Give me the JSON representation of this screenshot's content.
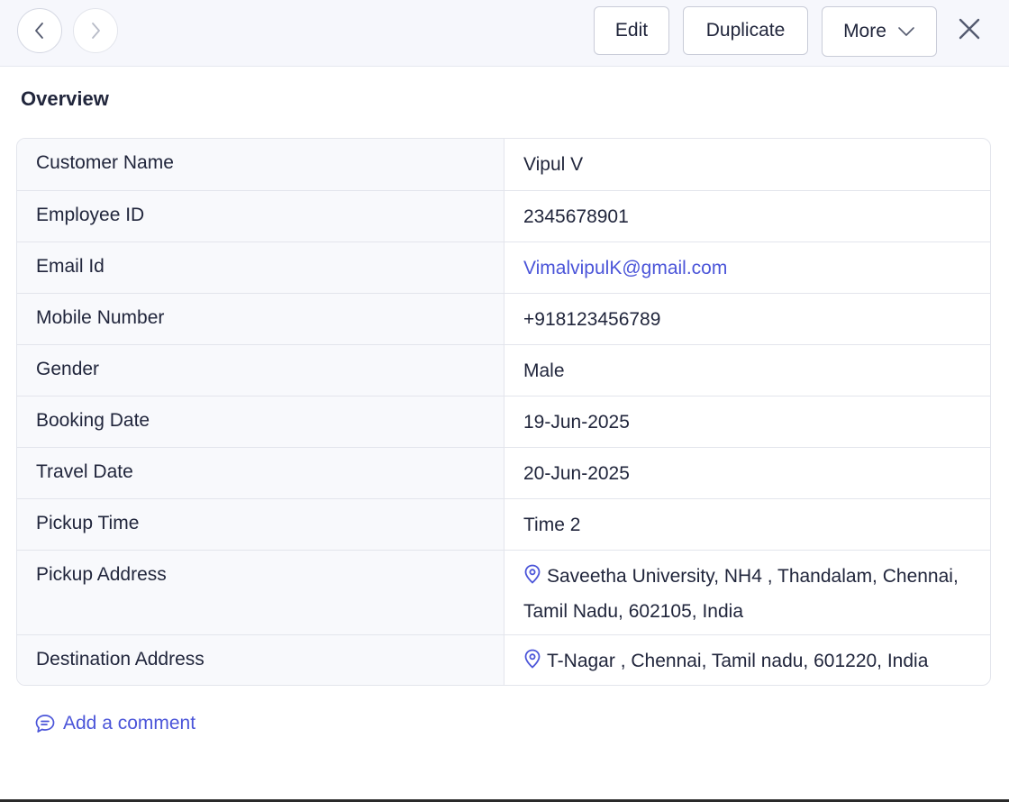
{
  "toolbar": {
    "edit_label": "Edit",
    "duplicate_label": "Duplicate",
    "more_label": "More"
  },
  "section": {
    "title": "Overview"
  },
  "fields": [
    {
      "label": "Customer Name",
      "value": "Vipul V"
    },
    {
      "label": "Employee ID",
      "value": "2345678901"
    },
    {
      "label": "Email Id",
      "value": "VimalvipulK@gmail.com"
    },
    {
      "label": "Mobile Number",
      "value": "+918123456789"
    },
    {
      "label": "Gender",
      "value": "Male"
    },
    {
      "label": "Booking Date",
      "value": "19-Jun-2025"
    },
    {
      "label": "Travel Date",
      "value": "20-Jun-2025"
    },
    {
      "label": "Pickup Time",
      "value": "Time 2"
    },
    {
      "label": "Pickup Address",
      "value_line1": "Saveetha University, NH4 , Thandalam, Chennai,",
      "value_line2": "Tamil Nadu, 602105, India"
    },
    {
      "label": "Destination Address",
      "value": "T-Nagar , Chennai, Tamil nadu, 601220, India"
    }
  ],
  "comment": {
    "label": "Add a comment"
  },
  "icons": {
    "back": "chevron-left-icon",
    "forward": "chevron-right-icon",
    "more": "chevron-down-icon",
    "close": "close-icon",
    "location": "location-pin-icon",
    "comment": "comment-icon"
  },
  "colors": {
    "accent": "#4b55d9",
    "text": "#21263c",
    "toolbar_bg": "#f6f7fc",
    "label_bg": "#f8f9fc"
  }
}
